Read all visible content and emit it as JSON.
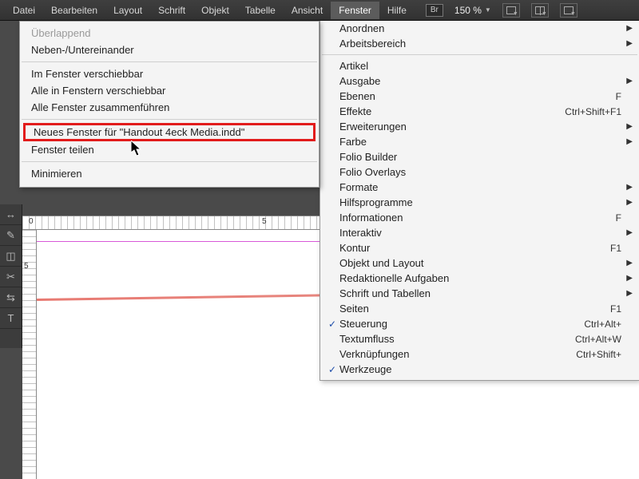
{
  "menubar": {
    "items": [
      "Datei",
      "Bearbeiten",
      "Layout",
      "Schrift",
      "Objekt",
      "Tabelle",
      "Ansicht",
      "Fenster",
      "Hilfe"
    ],
    "active_index": 7,
    "bridge_label": "Br",
    "zoom": "150 %"
  },
  "left_menu": {
    "items": [
      {
        "label": "Überlappend",
        "disabled": true
      },
      {
        "label": "Neben-/Untereinander"
      },
      {
        "sep": true
      },
      {
        "label": "Im Fenster verschiebbar"
      },
      {
        "label": "Alle in Fenstern verschiebbar"
      },
      {
        "label": "Alle Fenster zusammenführen"
      },
      {
        "sep": true
      },
      {
        "label": "Neues Fenster für \"Handout 4eck Media.indd\"",
        "highlight": true
      },
      {
        "label": "Fenster teilen"
      },
      {
        "sep": true
      },
      {
        "label": "Minimieren"
      }
    ]
  },
  "right_menu": {
    "items": [
      {
        "label": "Anordnen",
        "sub": true
      },
      {
        "label": "Arbeitsbereich",
        "sub": true
      },
      {
        "sep": true
      },
      {
        "label": "Artikel"
      },
      {
        "label": "Ausgabe",
        "sub": true
      },
      {
        "label": "Ebenen",
        "shortcut": "F"
      },
      {
        "label": "Effekte",
        "shortcut": "Ctrl+Shift+F1"
      },
      {
        "label": "Erweiterungen",
        "sub": true
      },
      {
        "label": "Farbe",
        "sub": true
      },
      {
        "label": "Folio Builder"
      },
      {
        "label": "Folio Overlays"
      },
      {
        "label": "Formate",
        "sub": true
      },
      {
        "label": "Hilfsprogramme",
        "sub": true
      },
      {
        "label": "Informationen",
        "shortcut": "F"
      },
      {
        "label": "Interaktiv",
        "sub": true
      },
      {
        "label": "Kontur",
        "shortcut": "F1"
      },
      {
        "label": "Objekt und Layout",
        "sub": true
      },
      {
        "label": "Redaktionelle Aufgaben",
        "sub": true
      },
      {
        "label": "Schrift und Tabellen",
        "sub": true
      },
      {
        "label": "Seiten",
        "shortcut": "F1"
      },
      {
        "label": "Steuerung",
        "checked": true,
        "shortcut": "Ctrl+Alt+"
      },
      {
        "label": "Textumfluss",
        "shortcut": "Ctrl+Alt+W"
      },
      {
        "label": "Verknüpfungen",
        "shortcut": "Ctrl+Shift+"
      },
      {
        "label": "Werkzeuge",
        "checked": true
      }
    ]
  },
  "ruler_h": [
    "0",
    "5"
  ],
  "ruler_v": [
    "5"
  ]
}
